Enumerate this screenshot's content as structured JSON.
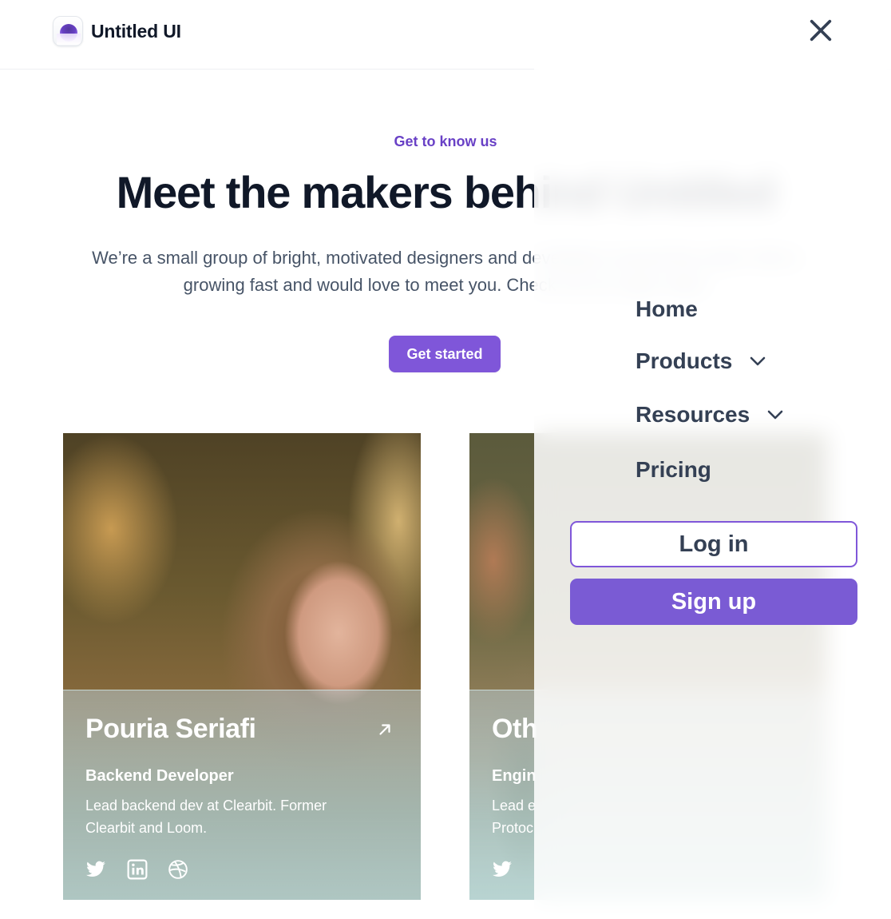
{
  "brand": {
    "name": "Untitled UI",
    "logo_icon": "untitled-ui-logo-icon"
  },
  "hero": {
    "eyebrow": "Get to know us",
    "title": "Meet the makers behind Untitled",
    "subtitle": "We’re a small group of bright, motivated designers and developers around the world. We’re growing fast and would love to meet you. Check out our open roles!",
    "cta_label": "Get started"
  },
  "team": [
    {
      "name": "Pouria Seriafi",
      "role": "Backend Developer",
      "bio": "Lead backend dev at Clearbit. Former Clearbit and Loom.",
      "socials": [
        "twitter-icon",
        "linkedin-icon",
        "dribbble-icon"
      ]
    },
    {
      "name": "Oth",
      "role": "Engin",
      "bio_lines": [
        "Lead e",
        "Protoc"
      ],
      "socials": [
        "twitter-icon"
      ]
    }
  ],
  "menu": {
    "close_icon": "close-icon",
    "items": [
      {
        "label": "Home",
        "has_dropdown": false
      },
      {
        "label": "Products",
        "has_dropdown": true
      },
      {
        "label": "Resources",
        "has_dropdown": true
      },
      {
        "label": "Pricing",
        "has_dropdown": false
      }
    ],
    "login_label": "Log in",
    "signup_label": "Sign up"
  },
  "colors": {
    "primary": "#7f56d9",
    "eyebrow": "#6941c6",
    "heading": "#101828",
    "body": "#475467",
    "nav": "#344054"
  }
}
